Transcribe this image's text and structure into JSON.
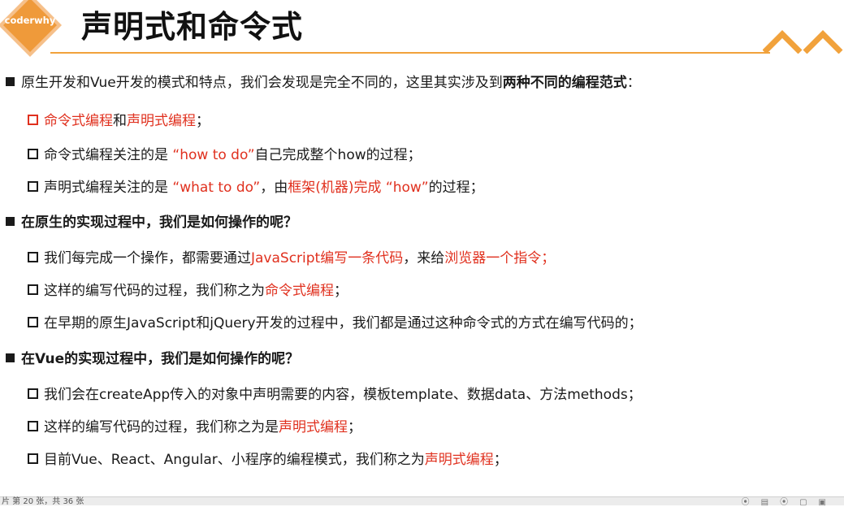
{
  "slide": {
    "logo_text": "coderwhy",
    "title": "声明式和命令式",
    "accent_color": "#f1a23c",
    "highlight_color": "#e0301e"
  },
  "bullets": [
    {
      "level": 1,
      "segments": [
        {
          "text": "原生开发和Vue开发的模式和特点，我们会发现是完全不同的，这里其实涉及到",
          "style": ""
        },
        {
          "text": "两种不同的编程范式",
          "style": "b"
        },
        {
          "text": "：",
          "style": ""
        }
      ]
    },
    {
      "level": 2,
      "marker": "red",
      "segments": [
        {
          "text": "命令式编程",
          "style": "red"
        },
        {
          "text": "和",
          "style": ""
        },
        {
          "text": "声明式编程",
          "style": "red"
        },
        {
          "text": "；",
          "style": ""
        }
      ]
    },
    {
      "level": 2,
      "segments": [
        {
          "text": "命令式编程关注的是 ",
          "style": ""
        },
        {
          "text": "“how to do”",
          "style": "red"
        },
        {
          "text": "自己完成整个how的过程；",
          "style": ""
        }
      ]
    },
    {
      "level": 2,
      "segments": [
        {
          "text": "声明式编程关注的是 ",
          "style": ""
        },
        {
          "text": "“what to do”",
          "style": "red"
        },
        {
          "text": "，由",
          "style": ""
        },
        {
          "text": "框架(机器)完成 ",
          "style": "red"
        },
        {
          "text": "“how”",
          "style": "red"
        },
        {
          "text": "的过程；",
          "style": ""
        }
      ]
    },
    {
      "level": 1,
      "bold": true,
      "segments": [
        {
          "text": "在原生的实现过程中，我们是如何操作的呢？",
          "style": "b"
        }
      ]
    },
    {
      "level": 2,
      "segments": [
        {
          "text": "我们每完成一个操作，都需要通过",
          "style": ""
        },
        {
          "text": "JavaScript编写一条代码",
          "style": "red"
        },
        {
          "text": "，来给",
          "style": ""
        },
        {
          "text": "浏览器一个指令；",
          "style": "red"
        }
      ]
    },
    {
      "level": 2,
      "segments": [
        {
          "text": "这样的编写代码的过程，我们称之为",
          "style": ""
        },
        {
          "text": "命令式编程",
          "style": "red"
        },
        {
          "text": "；",
          "style": ""
        }
      ]
    },
    {
      "level": 2,
      "segments": [
        {
          "text": "在早期的原生JavaScript和jQuery开发的过程中，我们都是通过这种命令式的方式在编写代码的；",
          "style": ""
        }
      ]
    },
    {
      "level": 1,
      "bold": true,
      "segments": [
        {
          "text": "在Vue的实现过程中，我们是如何操作的呢？",
          "style": "b"
        }
      ]
    },
    {
      "level": 2,
      "segments": [
        {
          "text": "我们会在createApp传入的对象中声明需要的内容，模板template、数据data、方法methods；",
          "style": ""
        }
      ]
    },
    {
      "level": 2,
      "segments": [
        {
          "text": "这样的编写代码的过程，我们称之为是",
          "style": ""
        },
        {
          "text": "声明式编程",
          "style": "red"
        },
        {
          "text": "；",
          "style": ""
        }
      ]
    },
    {
      "level": 2,
      "segments": [
        {
          "text": "目前Vue、React、Angular、小程序的编程模式，我们称之为",
          "style": ""
        },
        {
          "text": "声明式编程",
          "style": "red"
        },
        {
          "text": "；",
          "style": ""
        }
      ]
    }
  ],
  "statusbar": {
    "slide_info": "片 第 20 张，共 36 张"
  }
}
